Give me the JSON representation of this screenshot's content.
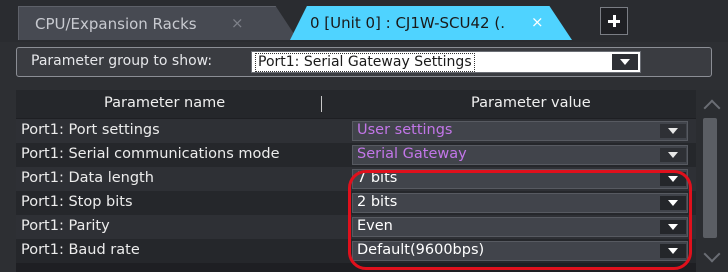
{
  "tabs": [
    {
      "label": "CPU/Expansion Racks",
      "close": "×"
    },
    {
      "label": "0 [Unit 0] : CJ1W-SCU42 (.",
      "close": "×"
    }
  ],
  "add_tab_icon": "plus-icon",
  "filter": {
    "label": "Parameter group to show:",
    "value": "Port1: Serial Gateway Settings"
  },
  "grid": {
    "columns": [
      "Parameter name",
      "Parameter value"
    ],
    "rows": [
      {
        "name": "Port1: Port settings",
        "value": "User settings",
        "style": "default"
      },
      {
        "name": "Port1: Serial communications mode",
        "value": "Serial Gateway",
        "style": "default"
      },
      {
        "name": "Port1: Data length",
        "value": "7 bits",
        "style": "changed"
      },
      {
        "name": "Port1: Stop bits",
        "value": "2 bits",
        "style": "changed"
      },
      {
        "name": "Port1: Parity",
        "value": "Even",
        "style": "changed"
      },
      {
        "name": "Port1: Baud rate",
        "value": "Default(9600bps)",
        "style": "changed"
      }
    ]
  },
  "colors": {
    "active_tab": "#4fd3ff",
    "default_value_text": "#c276e8",
    "changed_value_text": "#ffffff",
    "highlight": "#e0101c"
  }
}
